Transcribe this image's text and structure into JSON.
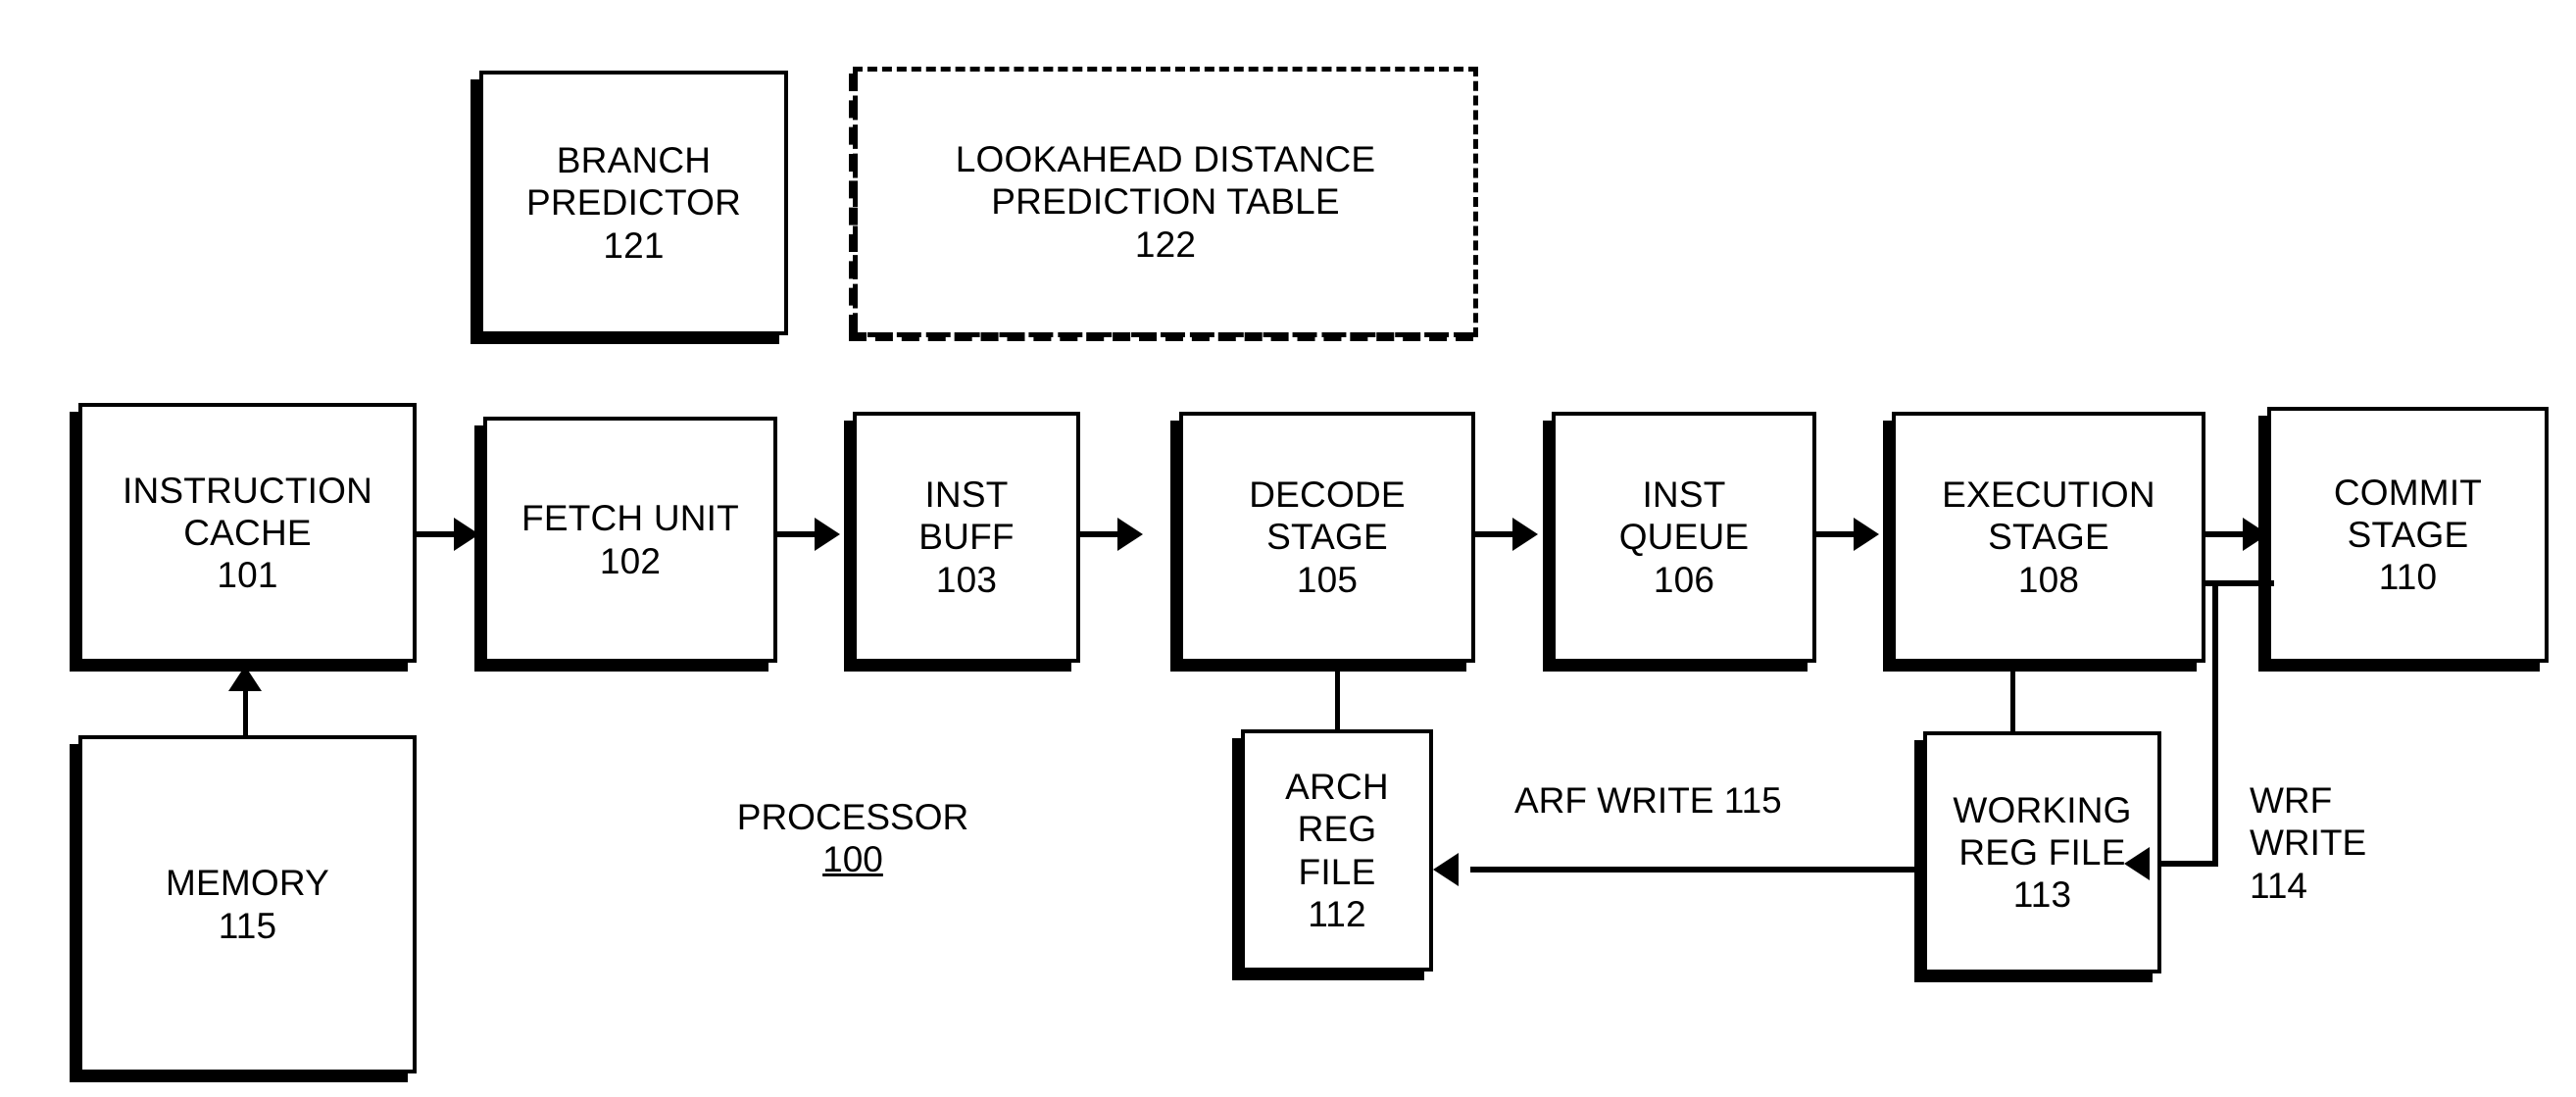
{
  "figure": {
    "title": "PROCESSOR",
    "title_ref": "100"
  },
  "blocks": {
    "branch_predictor": {
      "line1": "BRANCH",
      "line2": "PREDICTOR",
      "ref": "121"
    },
    "lookahead_table": {
      "line1": "LOOKAHEAD DISTANCE",
      "line2": "PREDICTION TABLE",
      "ref": "122"
    },
    "instruction_cache": {
      "line1": "INSTRUCTION",
      "line2": "CACHE",
      "ref": "101"
    },
    "fetch_unit": {
      "line1": "FETCH UNIT",
      "ref": "102"
    },
    "inst_buff": {
      "line1": "INST",
      "line2": "BUFF",
      "ref": "103"
    },
    "decode_stage": {
      "line1": "DECODE",
      "line2": "STAGE",
      "ref": "105"
    },
    "inst_queue": {
      "line1": "INST",
      "line2": "QUEUE",
      "ref": "106"
    },
    "execution_stage": {
      "line1": "EXECUTION",
      "line2": "STAGE",
      "ref": "108"
    },
    "commit_stage": {
      "line1": "COMMIT",
      "line2": "STAGE",
      "ref": "110"
    },
    "memory": {
      "line1": "MEMORY",
      "ref": "115"
    },
    "arch_reg_file": {
      "line1": "ARCH",
      "line2": "REG",
      "line3": "FILE",
      "ref": "112"
    },
    "working_reg_file": {
      "line1": "WORKING",
      "line2": "REG FILE",
      "ref": "113"
    }
  },
  "connectors": {
    "arf_write": {
      "label": "ARF WRITE 115"
    },
    "wrf_write": {
      "line1": "WRF",
      "line2": "WRITE",
      "ref": "114"
    }
  }
}
